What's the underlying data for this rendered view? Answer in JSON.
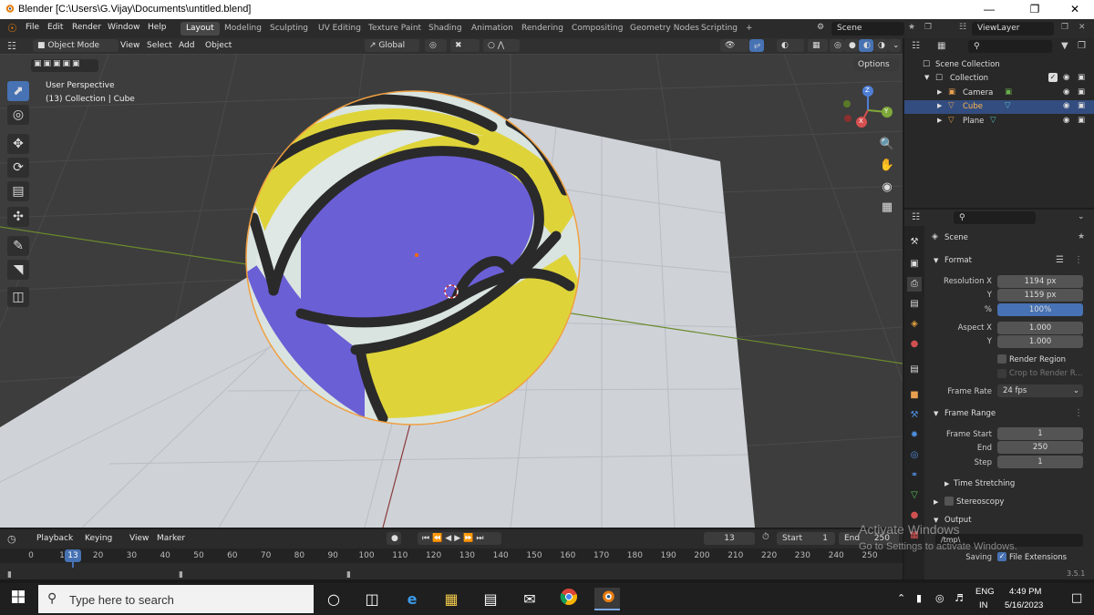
{
  "window": {
    "title": "Blender [C:\\Users\\G.Vijay\\Documents\\untitled.blend]"
  },
  "menu": {
    "items": [
      "File",
      "Edit",
      "Render",
      "Window",
      "Help"
    ]
  },
  "workspaces": [
    "Layout",
    "Modeling",
    "Sculpting",
    "UV Editing",
    "Texture Paint",
    "Shading",
    "Animation",
    "Rendering",
    "Compositing",
    "Geometry Nodes",
    "Scripting"
  ],
  "add_workspace": "+",
  "scene": {
    "name": "Scene",
    "view_layer": "ViewLayer"
  },
  "viewport_header": {
    "mode": "Object Mode",
    "menus": [
      "View",
      "Select",
      "Add",
      "Object"
    ],
    "orientation": "Global",
    "options": "Options"
  },
  "viewport": {
    "perspective": "User Perspective",
    "collection_info": "(13) Collection | Cube",
    "gizmo_axes": [
      "X",
      "Y",
      "Z"
    ]
  },
  "outliner": {
    "root": "Scene Collection",
    "collection": "Collection",
    "objects": [
      {
        "name": "Camera",
        "selected": false
      },
      {
        "name": "Cube",
        "selected": true
      },
      {
        "name": "Plane",
        "selected": false
      }
    ]
  },
  "properties": {
    "context": "Scene",
    "format": {
      "header": "Format",
      "resolution_x_label": "Resolution X",
      "resolution_x": "1194 px",
      "y_label": "Y",
      "resolution_y": "1159 px",
      "percent_label": "%",
      "percent": "100%",
      "aspect_x_label": "Aspect X",
      "aspect_x": "1.000",
      "aspect_y": "1.000",
      "render_region": "Render Region",
      "crop": "Crop to Render R...",
      "frame_rate_label": "Frame Rate",
      "frame_rate": "24 fps"
    },
    "frame_range": {
      "header": "Frame Range",
      "start_label": "Frame Start",
      "start": "1",
      "end_label": "End",
      "end": "250",
      "step_label": "Step",
      "step": "1"
    },
    "time_stretching": "Time Stretching",
    "stereoscopy": "Stereoscopy",
    "output": {
      "header": "Output",
      "path": "/tmp\\",
      "saving_label": "Saving",
      "file_extensions": "File Extensions"
    },
    "version": "3.5.1"
  },
  "timeline": {
    "menus": [
      "Playback",
      "Keying",
      "View",
      "Marker"
    ],
    "current_frame": "13",
    "start_label": "Start",
    "start": "1",
    "end_label": "End",
    "end": "250",
    "ticks": [
      "0",
      "10",
      "20",
      "30",
      "40",
      "50",
      "60",
      "70",
      "80",
      "90",
      "100",
      "110",
      "120",
      "130",
      "140",
      "150",
      "160",
      "170",
      "180",
      "190",
      "200",
      "210",
      "220",
      "230",
      "240",
      "250"
    ],
    "playhead": "13"
  },
  "activation": {
    "line1": "Activate Windows",
    "line2": "Go to Settings to activate Windows."
  },
  "taskbar": {
    "search_placeholder": "Type here to search",
    "lang1": "ENG",
    "lang2": "IN",
    "time": "4:49 PM",
    "date": "5/16/2023"
  }
}
